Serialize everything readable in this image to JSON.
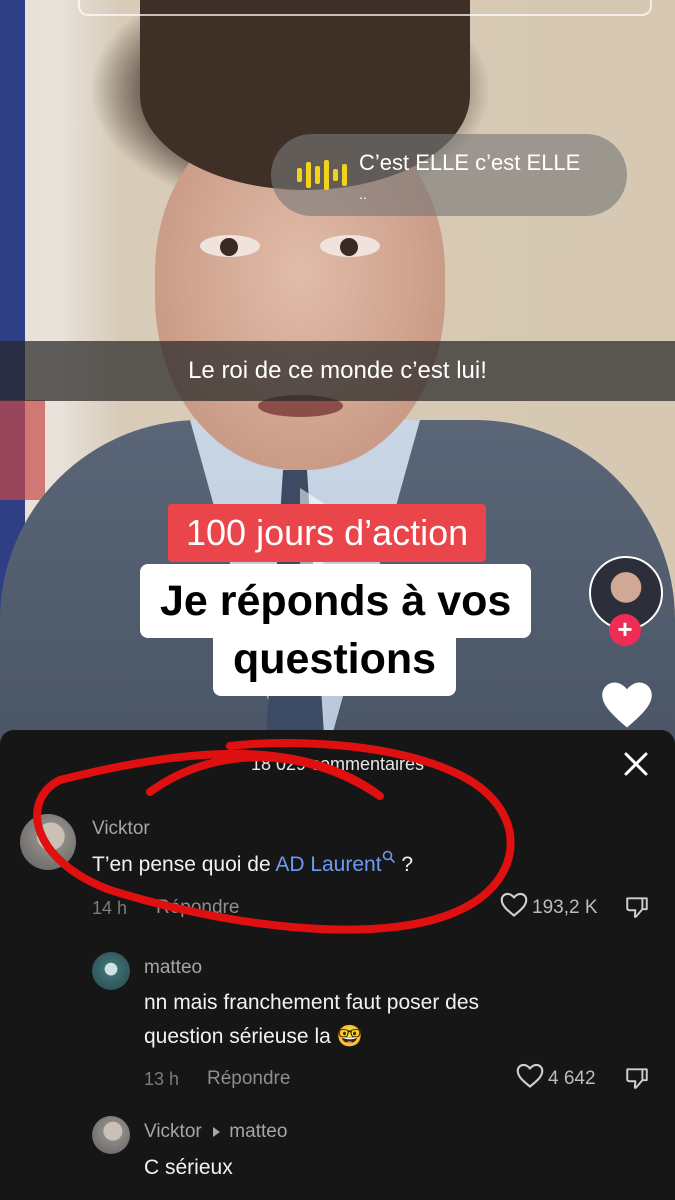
{
  "sound": {
    "title": "C’est ELLE c’est ELLE",
    "subtitle": ".."
  },
  "video": {
    "caption": "Le roi de ce monde c’est lui!",
    "overlay_red": "100 jours d’action",
    "overlay_line1": "Je réponds à vos",
    "overlay_line2": "questions"
  },
  "comments_panel": {
    "count_label": "18 029 commentaires",
    "comments": [
      {
        "user": "Vicktor",
        "text_before": "T’en pense quoi de ",
        "link": "AD Laurent",
        "text_after": " ?",
        "time": "14 h",
        "reply": "Répondre",
        "likes": "193,2 K"
      },
      {
        "user": "matteo",
        "line1": "nn mais franchement faut poser des",
        "line2": "question sérieuse la 🤓",
        "time": "13 h",
        "reply": "Répondre",
        "likes": "4 642"
      },
      {
        "user": "Vicktor",
        "reply_to": "matteo",
        "text": "C sérieux"
      }
    ]
  },
  "colors": {
    "accent_red": "#e9454a",
    "follow": "#f02c55",
    "link": "#6b9bf5",
    "sound_icon": "#f2d21c",
    "annotation": "#e01010"
  }
}
